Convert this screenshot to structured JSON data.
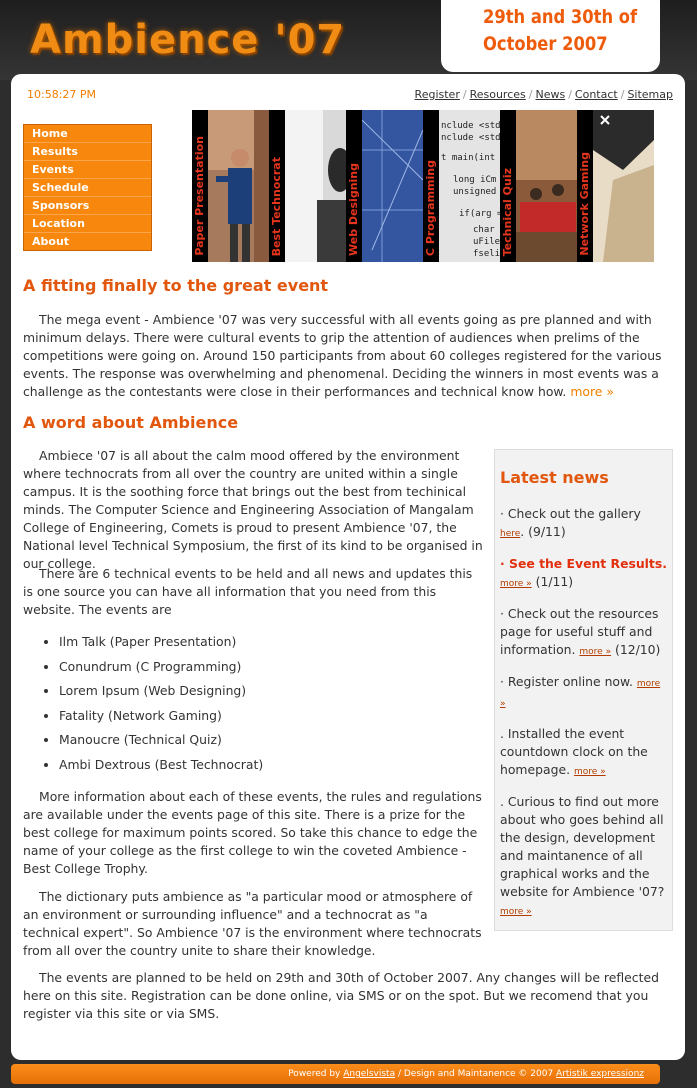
{
  "header": {
    "logo_text": "Ambience '07",
    "date_line1": "29th and 30th of",
    "date_line2": "October 2007"
  },
  "clock": "10:58:27 PM",
  "toplinks": [
    "Register",
    "Resources",
    "News",
    "Contact",
    "Sitemap"
  ],
  "menu": [
    "Home",
    "Results",
    "Events",
    "Schedule",
    "Sponsors",
    "Location",
    "About"
  ],
  "banner": [
    "Paper Presentation",
    "Best Technocrat",
    "Web Designing",
    "C Programming",
    "Technical Quiz",
    "Network Gaming"
  ],
  "code_snippet": [
    "nclude <stdi",
    "nclude <stdi",
    "t main(int a",
    "long iCm",
    "unsigned",
    "if(arg =",
    "char",
    "uFile",
    "fseli"
  ],
  "section1": {
    "heading": "A fitting finally to the great event",
    "text": "The mega event - Ambience '07 was very successful with all events going as pre planned and with minimum delays. There were cultural events to grip the attention of audiences when prelims of the competitions were going on. Around 150 participants from about 60 colleges registered for the various events. The response was overwhelming and phenomenal. Deciding the winners in most events was a challenge as the contestants were close in their performances and technical know how.",
    "more": "more »"
  },
  "section2": {
    "heading": "A word about Ambience",
    "p1": "Ambiece '07 is all about the calm mood offered by the environment where technocrats from all over the country are united within a single campus. It is the soothing force that brings out the best from techinical minds. The Computer Science and Engineering Association of Mangalam College of Engineering, Comets is proud to present Ambience '07, the National level Technical Symposium, the first of its kind to be organised in our college.",
    "p2": "There are 6 technical events to be held and all news and updates this is one source you can have all information that you need from this website. The events are",
    "events": [
      "Ilm Talk (Paper Presentation)",
      "Conundrum (C Programming)",
      "Lorem Ipsum (Web Designing)",
      "Fatality (Network Gaming)",
      "Manoucre (Technical Quiz)",
      "Ambi Dextrous (Best Technocrat)"
    ],
    "p3": "More information about each of these events, the rules and regulations are available under the events page of this site. There is a prize for the best college for maximum points scored. So take this chance to edge the name of your college as the first college to win the coveted Ambience - Best College Trophy.",
    "p4": "The dictionary puts ambience as \"a particular mood or atmosphere of an environment or surrounding influence\" and a technocrat as \"a technical expert\". So Ambience '07 is the environment where technocrats from all over the country unite to share their knowledge.",
    "p5": "The events are planned to be held on 29th and 30th of October 2007. Any changes will be reflected here on this site. Registration can be done online, via SMS or on the spot. But we recomend that you register via this site or via SMS."
  },
  "news": {
    "title": "Latest news",
    "items": [
      {
        "text": "· Check out the gallery ",
        "link": "here",
        "after": ". (9/11)"
      },
      {
        "text": "· See the Event Results.",
        "link": "more »",
        "after": " (1/11)"
      },
      {
        "text": "· Check out the resources page for useful stuff and information. ",
        "link": "more »",
        "after": " (12/10)"
      },
      {
        "text": "· Register online now. ",
        "link": "more »",
        "after": ""
      },
      {
        "text": ". Installed the event countdown clock on the homepage. ",
        "link": "more »",
        "after": ""
      },
      {
        "text": ". Curious to find out more about who goes behind all the design, development and maintanence of all graphical works and the website for Ambience '07?",
        "link": "more »",
        "after": ""
      }
    ]
  },
  "footer": {
    "powered": "Powered by ",
    "powered_link": "Angelsvista",
    "middle": " / Design and Maintanence © 2007 ",
    "design_link": "Artistik expressionz"
  },
  "colors": {
    "accent": "#f7870d",
    "heading": "#e2570e",
    "background": "#2d2d2d"
  }
}
